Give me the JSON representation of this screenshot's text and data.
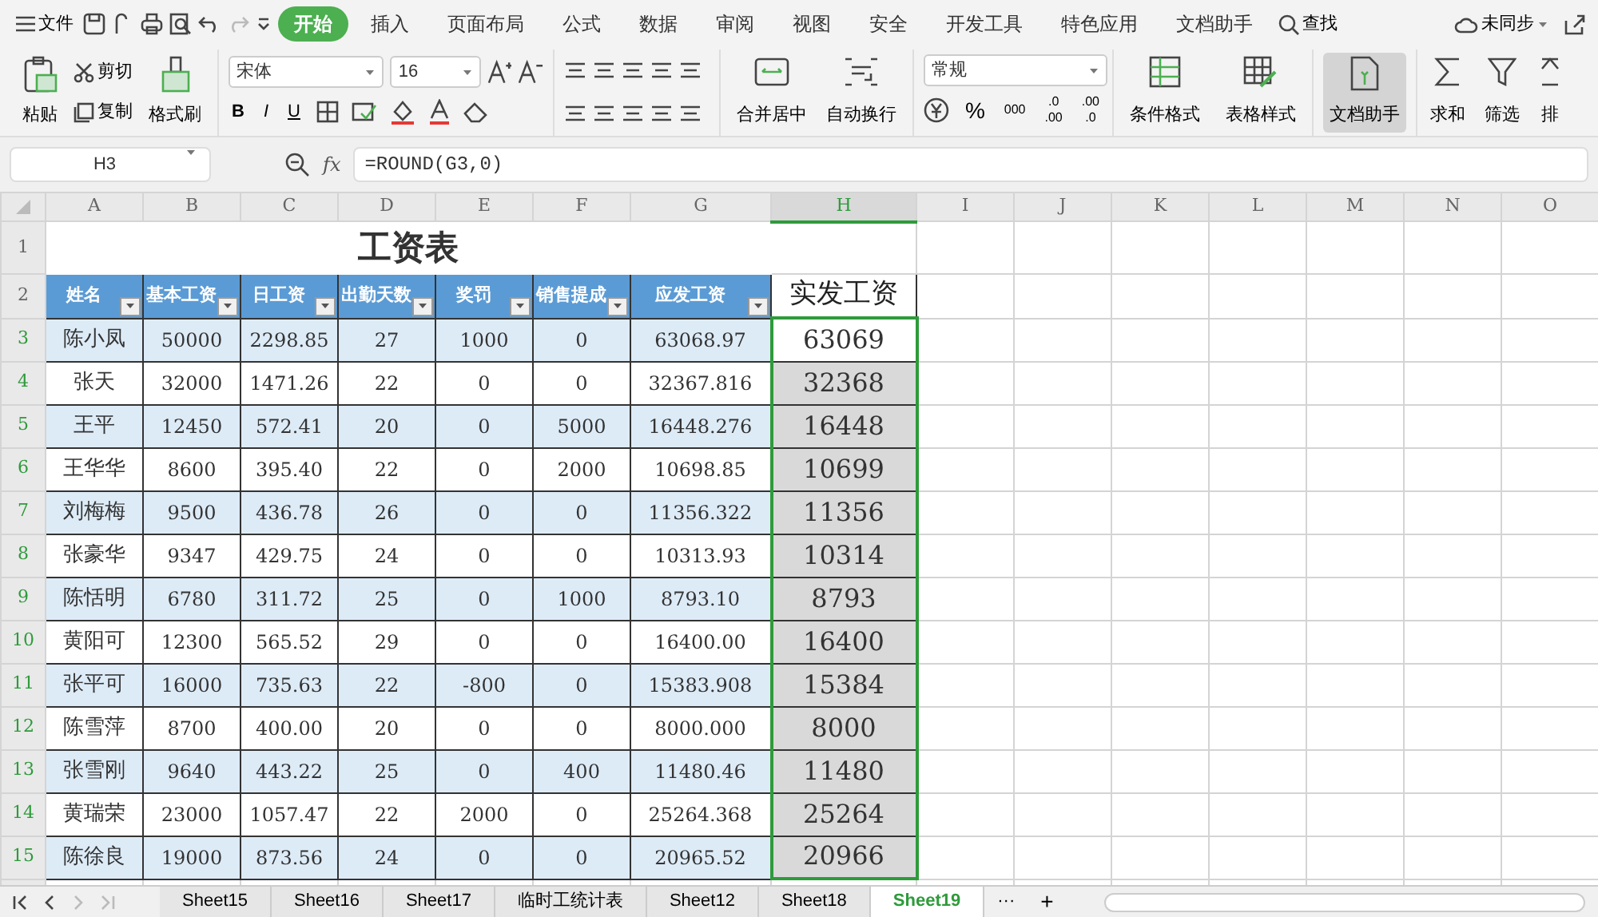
{
  "menu": {
    "file": "文件",
    "tabs": [
      {
        "label": "开始",
        "selected": true
      },
      {
        "label": "插入",
        "selected": false
      },
      {
        "label": "页面布局",
        "selected": false
      },
      {
        "label": "公式",
        "selected": false
      },
      {
        "label": "数据",
        "selected": false
      },
      {
        "label": "审阅",
        "selected": false
      },
      {
        "label": "视图",
        "selected": false
      },
      {
        "label": "安全",
        "selected": false
      },
      {
        "label": "开发工具",
        "selected": false
      },
      {
        "label": "特色应用",
        "selected": false
      },
      {
        "label": "文档助手",
        "selected": false
      }
    ],
    "search": "查找",
    "sync": "未同步"
  },
  "toolbar": {
    "paste": "粘贴",
    "cut": "剪切",
    "copy": "复制",
    "format_painter": "格式刷",
    "font_name": "宋体",
    "font_size": "16",
    "bold": "B",
    "italic": "I",
    "underline": "U",
    "merge": "合并居中",
    "wrap": "自动换行",
    "number_format": "常规",
    "percent": "%",
    "thousands": "000",
    "add_decimal": [
      ".0",
      ".00"
    ],
    "remove_decimal": [
      ".00",
      ".0"
    ],
    "conditional_format": "条件格式",
    "table_style": "表格样式",
    "doc_helper": {
      "label": "文档助手",
      "selected": true
    },
    "sum": "求和",
    "filter": "筛选",
    "sort": "排"
  },
  "formula_bar": {
    "cell": "H3",
    "fx": "fx",
    "formula": "=ROUND(G3,0)"
  },
  "columns": [
    {
      "label": "A",
      "selected": false
    },
    {
      "label": "B",
      "selected": false
    },
    {
      "label": "C",
      "selected": false
    },
    {
      "label": "D",
      "selected": false
    },
    {
      "label": "E",
      "selected": false
    },
    {
      "label": "F",
      "selected": false
    },
    {
      "label": "G",
      "selected": false
    },
    {
      "label": "H",
      "selected": true
    },
    {
      "label": "I",
      "selected": false
    },
    {
      "label": "J",
      "selected": false
    },
    {
      "label": "K",
      "selected": false
    },
    {
      "label": "L",
      "selected": false
    },
    {
      "label": "M",
      "selected": false
    },
    {
      "label": "N",
      "selected": false
    },
    {
      "label": "O",
      "selected": false
    }
  ],
  "title_row": {
    "number": "1",
    "text": "工资表"
  },
  "header_row": {
    "number": "2",
    "cells": [
      {
        "label": "姓名",
        "filter": true
      },
      {
        "label": "基本工资",
        "filter": true
      },
      {
        "label": "日工资",
        "filter": true
      },
      {
        "label": "出勤天数",
        "filter": true
      },
      {
        "label": "奖罚",
        "filter": true
      },
      {
        "label": "销售提成",
        "filter": true
      },
      {
        "label": "应发工资",
        "filter": true
      },
      {
        "label": "实发工资",
        "filter": false
      }
    ]
  },
  "rows": [
    {
      "number": "3",
      "selected": true,
      "active": true,
      "shaded": true,
      "cells": [
        "陈小凤",
        "50000",
        "2298.85",
        "27",
        "1000",
        "0",
        "63068.97",
        "63069"
      ]
    },
    {
      "number": "4",
      "selected": true,
      "active": false,
      "shaded": false,
      "cells": [
        "张天",
        "32000",
        "1471.26",
        "22",
        "0",
        "0",
        "32367.816",
        "32368"
      ]
    },
    {
      "number": "5",
      "selected": true,
      "active": false,
      "shaded": true,
      "cells": [
        "王平",
        "12450",
        "572.41",
        "20",
        "0",
        "5000",
        "16448.276",
        "16448"
      ]
    },
    {
      "number": "6",
      "selected": true,
      "active": false,
      "shaded": false,
      "cells": [
        "王华华",
        "8600",
        "395.40",
        "22",
        "0",
        "2000",
        "10698.85",
        "10699"
      ]
    },
    {
      "number": "7",
      "selected": true,
      "active": false,
      "shaded": true,
      "cells": [
        "刘梅梅",
        "9500",
        "436.78",
        "26",
        "0",
        "0",
        "11356.322",
        "11356"
      ]
    },
    {
      "number": "8",
      "selected": true,
      "active": false,
      "shaded": false,
      "cells": [
        "张豪华",
        "9347",
        "429.75",
        "24",
        "0",
        "0",
        "10313.93",
        "10314"
      ]
    },
    {
      "number": "9",
      "selected": true,
      "active": false,
      "shaded": true,
      "cells": [
        "陈恬明",
        "6780",
        "311.72",
        "25",
        "0",
        "1000",
        "8793.10",
        "8793"
      ]
    },
    {
      "number": "10",
      "selected": true,
      "active": false,
      "shaded": false,
      "cells": [
        "黄阳可",
        "12300",
        "565.52",
        "29",
        "0",
        "0",
        "16400.00",
        "16400"
      ]
    },
    {
      "number": "11",
      "selected": true,
      "active": false,
      "shaded": true,
      "cells": [
        "张平可",
        "16000",
        "735.63",
        "22",
        "-800",
        "0",
        "15383.908",
        "15384"
      ]
    },
    {
      "number": "12",
      "selected": true,
      "active": false,
      "shaded": false,
      "cells": [
        "陈雪萍",
        "8700",
        "400.00",
        "20",
        "0",
        "0",
        "8000.000",
        "8000"
      ]
    },
    {
      "number": "13",
      "selected": true,
      "active": false,
      "shaded": true,
      "cells": [
        "张雪刚",
        "9640",
        "443.22",
        "25",
        "0",
        "400",
        "11480.46",
        "11480"
      ]
    },
    {
      "number": "14",
      "selected": true,
      "active": false,
      "shaded": false,
      "cells": [
        "黄瑞荣",
        "23000",
        "1057.47",
        "22",
        "2000",
        "0",
        "25264.368",
        "25264"
      ]
    },
    {
      "number": "15",
      "selected": true,
      "active": false,
      "shaded": true,
      "cells": [
        "陈徐良",
        "19000",
        "873.56",
        "24",
        "0",
        "0",
        "20965.52",
        "20966"
      ]
    }
  ],
  "sheets": [
    {
      "label": "Sheet15",
      "selected": false
    },
    {
      "label": "Sheet16",
      "selected": false
    },
    {
      "label": "Sheet17",
      "selected": false
    },
    {
      "label": "临时工统计表",
      "selected": false
    },
    {
      "label": "Sheet12",
      "selected": false
    },
    {
      "label": "Sheet18",
      "selected": false
    },
    {
      "label": "Sheet19",
      "selected": true
    }
  ],
  "sheet_more": "···",
  "sheet_add": "+"
}
